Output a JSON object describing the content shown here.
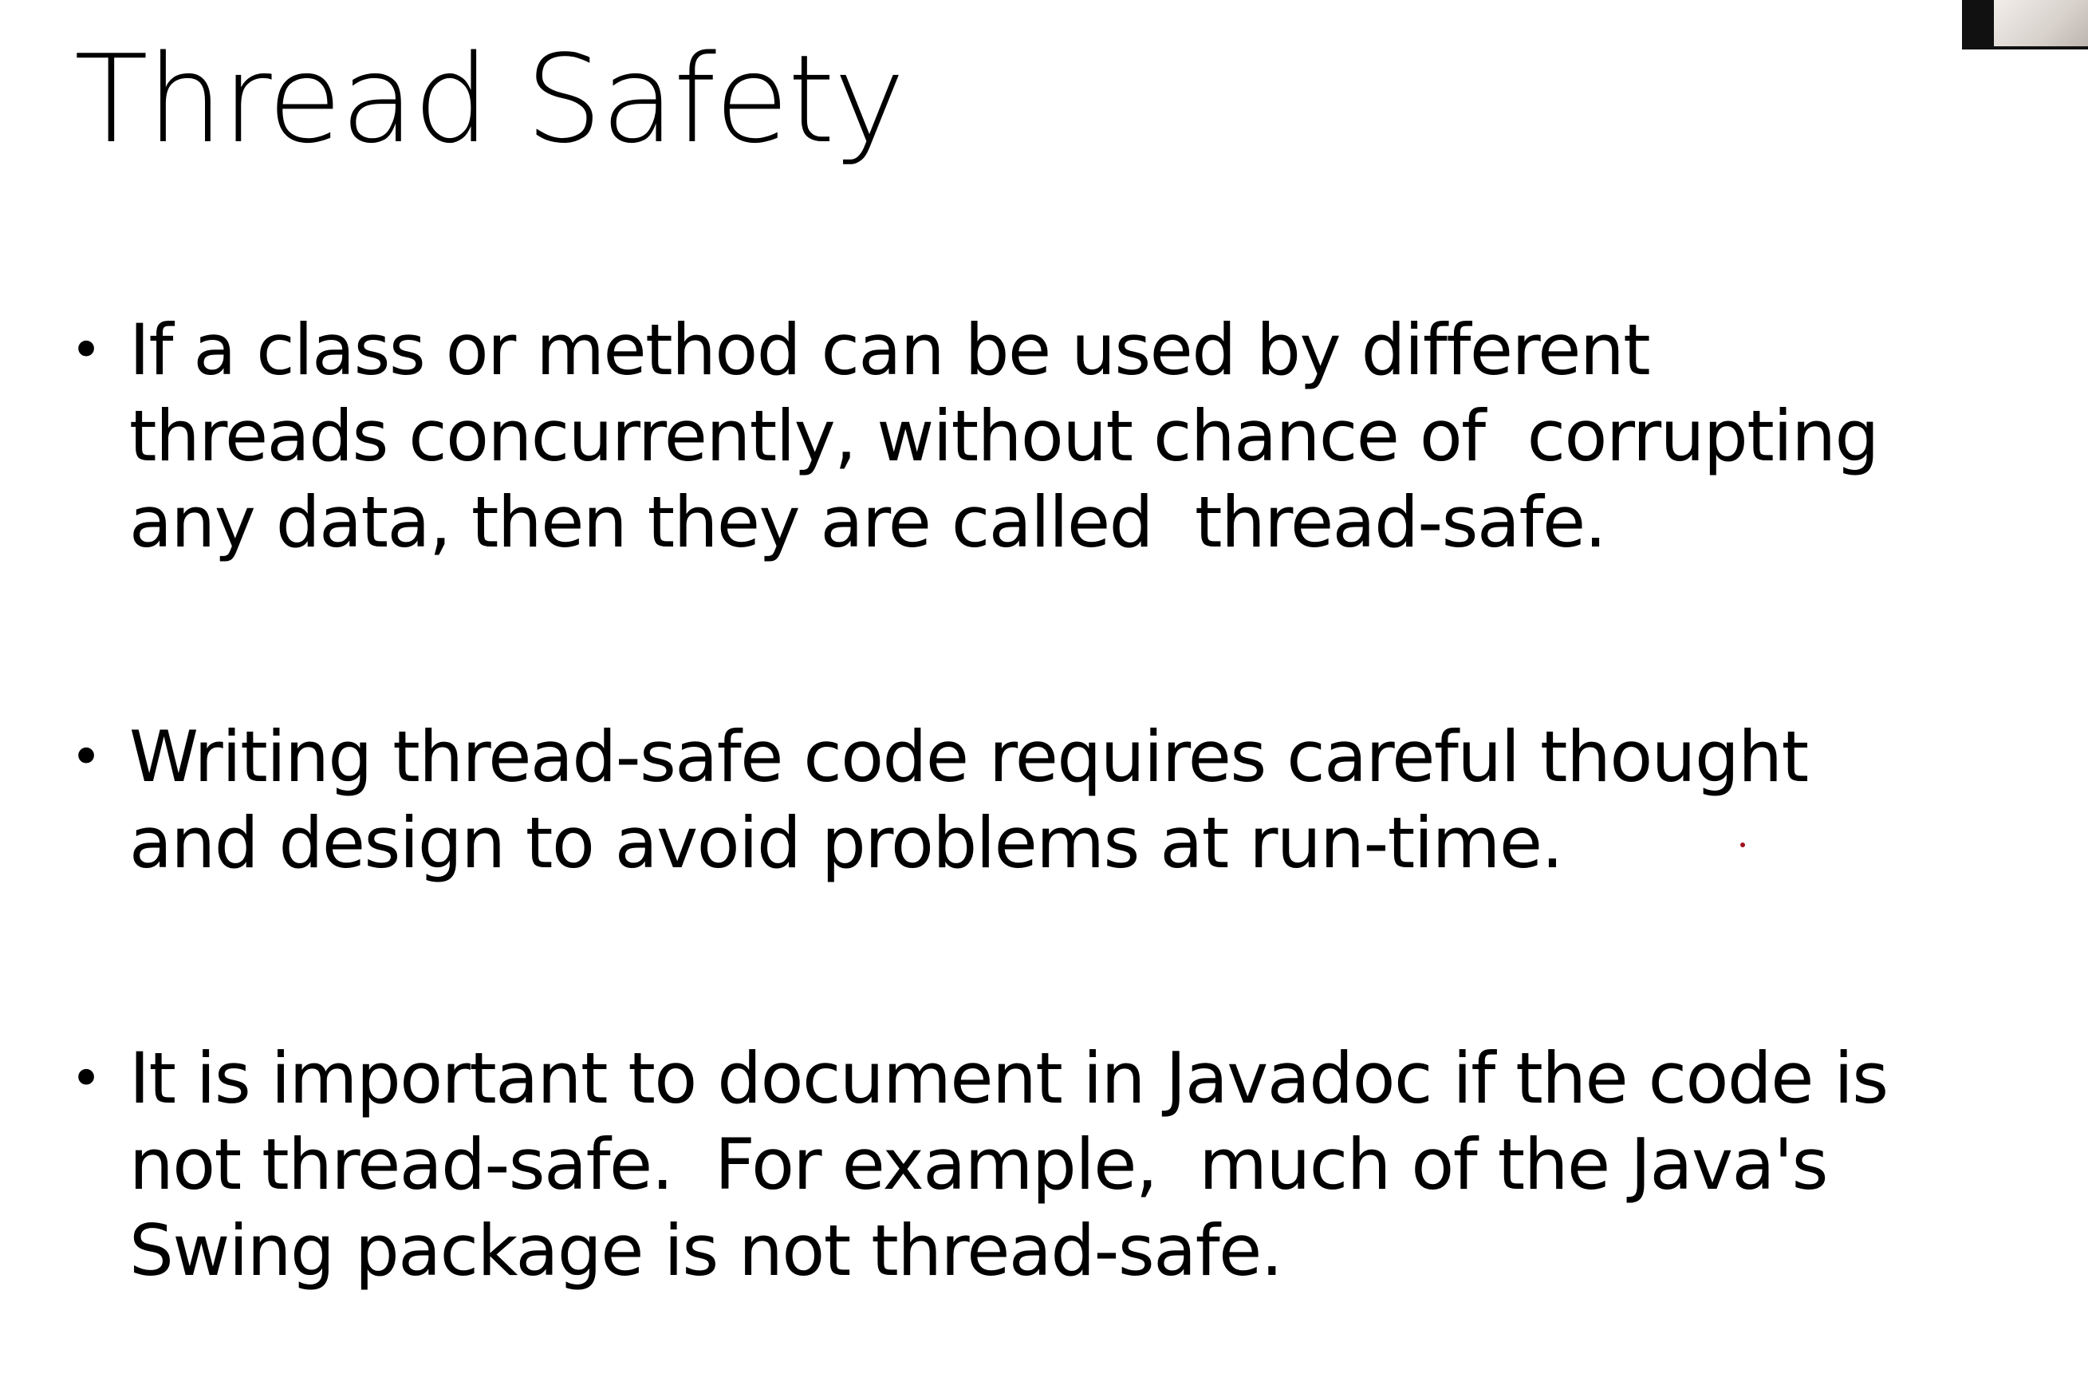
{
  "slide": {
    "title": "Thread Safety",
    "bullet_symbol": "•",
    "bullets": [
      {
        "text": "If a class or method can be used by different\nthreads concurrently, without chance of  corrupting\nany data, then they are called  thread-safe."
      },
      {
        "text": "Writing thread-safe code requires careful thought\nand design to avoid problems at run-time."
      },
      {
        "text": "It is important to document in Javadoc if the code is\nnot thread-safe.  For example,  much of the Java's\nSwing package is not thread-safe."
      }
    ]
  },
  "colors": {
    "background": "#ffffff",
    "text": "#000000",
    "pointer": "#a0141e"
  }
}
